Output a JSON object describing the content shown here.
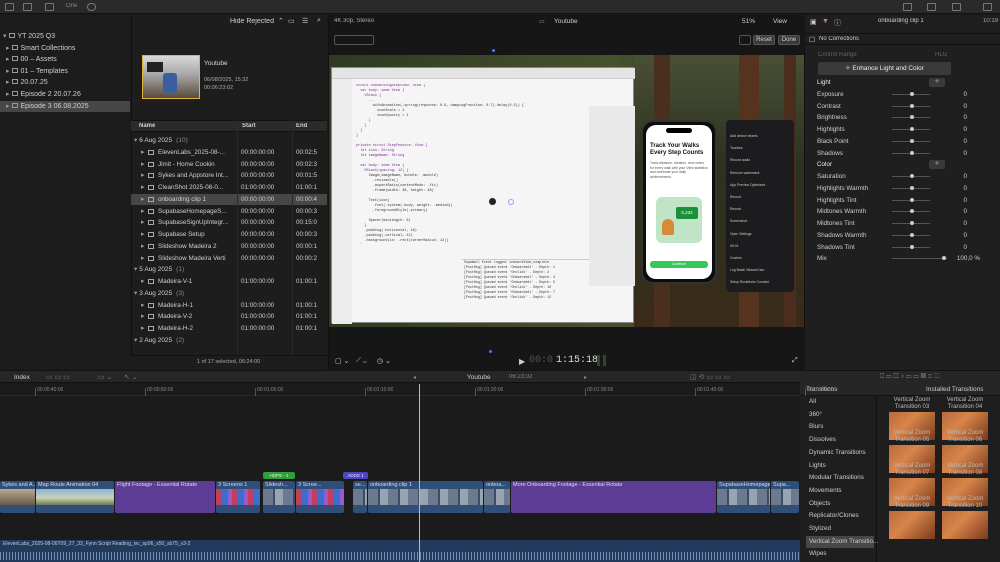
{
  "topbar": {
    "title": "One"
  },
  "library": {
    "items": [
      {
        "label": "YT 2025 Q3",
        "arrow": "▾"
      },
      {
        "label": "Smart Collections",
        "arrow": "▸"
      },
      {
        "label": "00 – Assets",
        "arrow": "▸"
      },
      {
        "label": "01 – Templates",
        "arrow": "▸"
      },
      {
        "label": "20.07.25",
        "arrow": "▸"
      },
      {
        "label": "Episode 2 20.07.26",
        "arrow": "▸"
      },
      {
        "label": "Episode 3 06.08.2025",
        "arrow": "▸"
      }
    ]
  },
  "browser": {
    "filter": "Hide Rejected",
    "event": {
      "title": "Youtube",
      "date": "06/08/2025, 15:32",
      "duration": "00:06:23:02"
    },
    "columns": {
      "name": "Name",
      "start": "Start",
      "end": "End"
    },
    "rows": [
      {
        "type": "group",
        "name": "6 Aug 2025",
        "count": "(10)"
      },
      {
        "type": "clip",
        "name": "ElevenLabs_2025-08-...",
        "start": "00:00:00:00",
        "end": "00:02:5"
      },
      {
        "type": "clip",
        "name": "Jimit - Home Cookin",
        "start": "00:00:00:00",
        "end": "00:02:3"
      },
      {
        "type": "clip",
        "name": "Sykes and Appstore Int...",
        "start": "00:00:00:00",
        "end": "00:01:5"
      },
      {
        "type": "clip",
        "name": "CleanShot 2025-08-0...",
        "start": "01:00:00:00",
        "end": "01:00:1"
      },
      {
        "type": "clip",
        "name": "onboarding clip 1",
        "start": "00:00:00:00",
        "end": "00:00:4"
      },
      {
        "type": "clip",
        "name": "SupabaseHomepageS...",
        "start": "00:00:00:00",
        "end": "00:00:3"
      },
      {
        "type": "clip",
        "name": "SupabaseSignUpIntegr...",
        "start": "00:00:00:00",
        "end": "00:15:0"
      },
      {
        "type": "clip",
        "name": "Supabase Setup",
        "start": "00:00:00:00",
        "end": "00:00:3"
      },
      {
        "type": "clip",
        "name": "Slideshow Madeira 2",
        "start": "00:00:00:00",
        "end": "00:00:1"
      },
      {
        "type": "clip",
        "name": "Slideshow Madeira Verti",
        "start": "00:00:00:00",
        "end": "00:00:2"
      },
      {
        "type": "group",
        "name": "5 Aug 2025",
        "count": "(1)"
      },
      {
        "type": "clip",
        "name": "Madeira-V-1",
        "start": "01:00:00:00",
        "end": "01:00:1"
      },
      {
        "type": "group",
        "name": "3 Aug 2025",
        "count": "(3)"
      },
      {
        "type": "clip",
        "name": "Madeira-H-1",
        "start": "01:00:00:00",
        "end": "01:00:1"
      },
      {
        "type": "clip",
        "name": "Madeira-V-2",
        "start": "01:00:00:00",
        "end": "01:00:1"
      },
      {
        "type": "clip",
        "name": "Madeira-H-2",
        "start": "01:00:00:00",
        "end": "01:00:1"
      },
      {
        "type": "group",
        "name": "2 Aug 2025",
        "count": "(2)"
      }
    ],
    "status": "1 of 17 selected, 06:24:00"
  },
  "viewer": {
    "format": "4K 30p, Stereo",
    "title": "Youtube",
    "zoom": "51%",
    "view": "View",
    "reset": "Reset",
    "done": "Done",
    "timecode": "1:15:18",
    "timecode_dim": "00:0",
    "phone": {
      "headline": "Track Your Walks Every Step Counts",
      "body": "Track distance, duration, and routes for every walk with your View statistics and celebrate your daily achievements.",
      "count": "5,232",
      "button": "Continue"
    },
    "panel_items": [
      "Add device bezels",
      "Touches",
      "Record audio",
      "Remove watermark",
      "App Preview Optimized",
      "Record",
      "Record",
      "Screenshot",
      "Open Settings",
      "09:41",
      "Custom",
      "Log Batch StreamCam",
      "Setup Rocketsim Connect"
    ],
    "console": [
      "SupaWall Event logged: onboardView_complete",
      "[PostHog] Queued event 'Onboarded1' - Depth: 1",
      "[PostHog] Queued event 'Onclick' - Depth: 2",
      "[PostHog] Queued event 'Onboarded1' - Depth: 4",
      "[PostHog] Queued event 'Onboarded1' - Depth: 5",
      "[PostHog] Queued event 'Onclick' - Depth: 10",
      "[PostHog] Queued event 'Onboarded1' - Depth: 7",
      "[PostHog] Queued event 'Onclick' - Depth: 12"
    ]
  },
  "inspector": {
    "clip_name": "onboarding clip 1",
    "duration": "10:19",
    "corrections": "No Corrections",
    "control_range": "Control Range",
    "hlg": "HLG",
    "enhance_button": "Enhance Light and Color",
    "params": [
      {
        "label": "Light",
        "value": ""
      },
      {
        "label": "Exposure",
        "value": "0"
      },
      {
        "label": "Contrast",
        "value": "0"
      },
      {
        "label": "Brightness",
        "value": "0"
      },
      {
        "label": "Highlights",
        "value": "0"
      },
      {
        "label": "Black Point",
        "value": "0"
      },
      {
        "label": "Shadows",
        "value": "0"
      },
      {
        "label": "Color",
        "value": ""
      },
      {
        "label": "Saturation",
        "value": "0"
      },
      {
        "label": "Highlights Warmth",
        "value": "0"
      },
      {
        "label": "Highlights Tint",
        "value": "0"
      },
      {
        "label": "Midtones Warmth",
        "value": "0"
      },
      {
        "label": "Midtones Tint",
        "value": "0"
      },
      {
        "label": "Shadows Warmth",
        "value": "0"
      },
      {
        "label": "Shadows Tint",
        "value": "0"
      },
      {
        "label": "Mix",
        "value": "100,0 %"
      }
    ]
  },
  "timeline": {
    "index": "Index",
    "project": "Youtube",
    "duration": "06:23:02",
    "ruler": [
      "00:00:40:00",
      "00:00:50:00",
      "00:01:00:00",
      "00:01:10:00",
      "00:01:20:00",
      "00:01:30:00",
      "00:01:40:00",
      "00:01:50:00"
    ],
    "clips": [
      "Sykes and A...",
      "Map Route Animation 04",
      "Flight Footage - Essential Rotate",
      "3 Screens 1",
      "Slidesh...",
      "3 Scree...",
      "se...",
      "onboarding clip 1",
      "onboa...",
      "More Onboarding Footage - Essential Rotate",
      "SupabaseHomepage...",
      "Supa..."
    ],
    "markers": [
      "HDPS - 4",
      "ADDS 1"
    ],
    "audio": "ElevenLabs_2025-08-06T09_27_33_Fynn Script Reading_ivc_sp96_s50_sb75_v3-2"
  },
  "transitions": {
    "title": "Transitions",
    "installed": "Installed Transitions",
    "categories": [
      "All",
      "360°",
      "Blurs",
      "Dissolves",
      "Dynamic Transitions",
      "Lights",
      "Modular Transitions",
      "Movements",
      "Objects",
      "Replicator/Clones",
      "Stylized",
      "Vertical Zoom Transitio...",
      "Wipes"
    ],
    "selected_index": 11,
    "thumbs": [
      "Vertical Zoom Transition 03",
      "Vertical Zoom Transition 04",
      "Vertical Zoom Transition 05",
      "Vertical Zoom Transition 06",
      "Vertical Zoom Transition 07",
      "Vertical Zoom Transition 08",
      "Vertical Zoom Transition 09",
      "Vertical Zoom Transition 10"
    ]
  },
  "colors": {
    "accent": "#2e6fd6",
    "selection": "#474747",
    "clip_video": "#2f4f79",
    "clip_title": "#5d3c96",
    "marker_green": "#2f9e3b"
  }
}
